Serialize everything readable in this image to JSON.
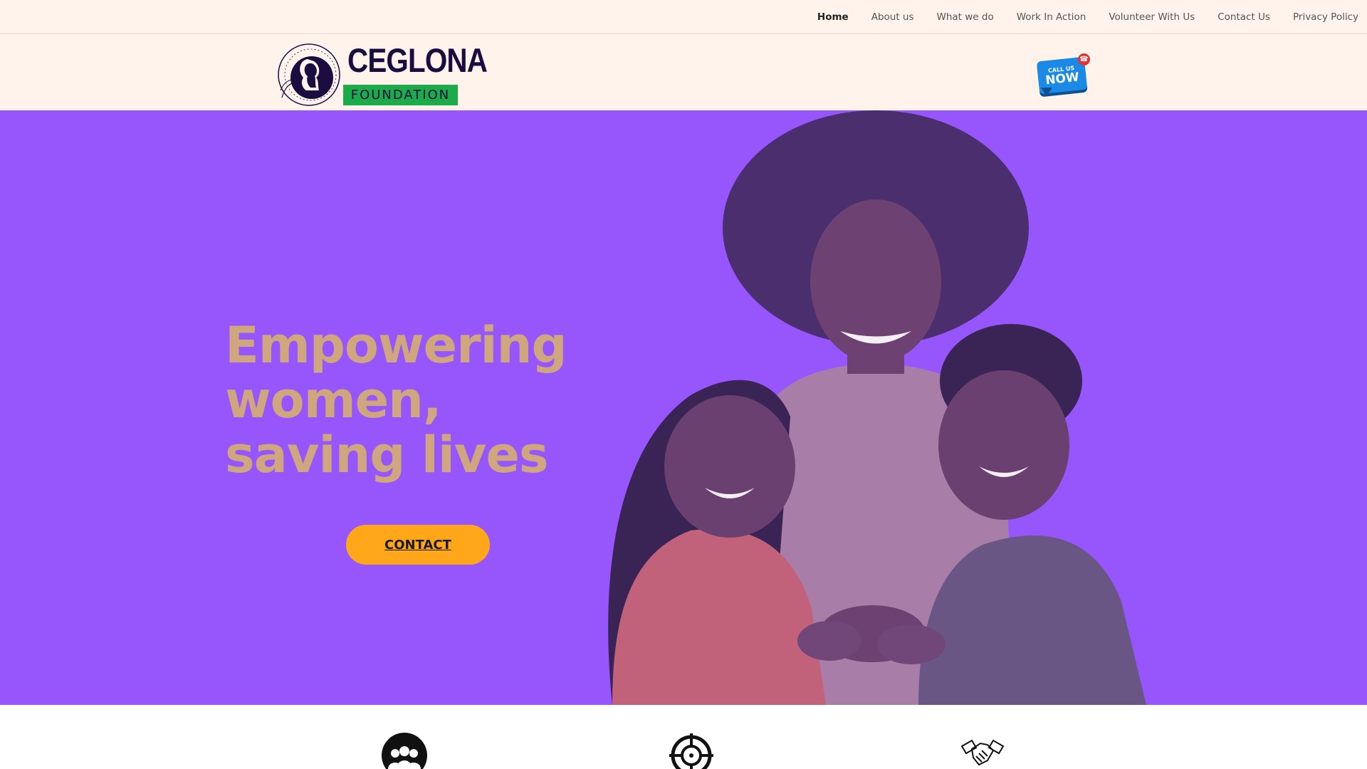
{
  "nav": {
    "items": [
      {
        "label": "Home",
        "active": true
      },
      {
        "label": "About us"
      },
      {
        "label": "What we do"
      },
      {
        "label": "Work In Action"
      },
      {
        "label": "Volunteer With Us"
      },
      {
        "label": "Contact Us"
      },
      {
        "label": "Privacy Policy"
      }
    ]
  },
  "logo": {
    "name": "CEGLONA",
    "subtitle": "FOUNDATION",
    "emblem_text": "CEGLONA FOUNDATION"
  },
  "call_button": {
    "line1": "CALL US",
    "line2": "NOW"
  },
  "hero": {
    "title_lines": [
      "Empowering",
      "women,",
      "saving lives"
    ],
    "cta_label": "CONTACT"
  },
  "features": {
    "icons": [
      "community-icon",
      "target-icon",
      "handshake-icon"
    ]
  },
  "colors": {
    "topbar_bg": "#fff3ec",
    "hero_bg": "#9656fc",
    "hero_title": "#cfa67d",
    "cta_bg": "#ffa719",
    "logo_green": "#1cab4a",
    "logo_navy": "#1b0d3f",
    "call_blue": "#1b8ae6"
  }
}
